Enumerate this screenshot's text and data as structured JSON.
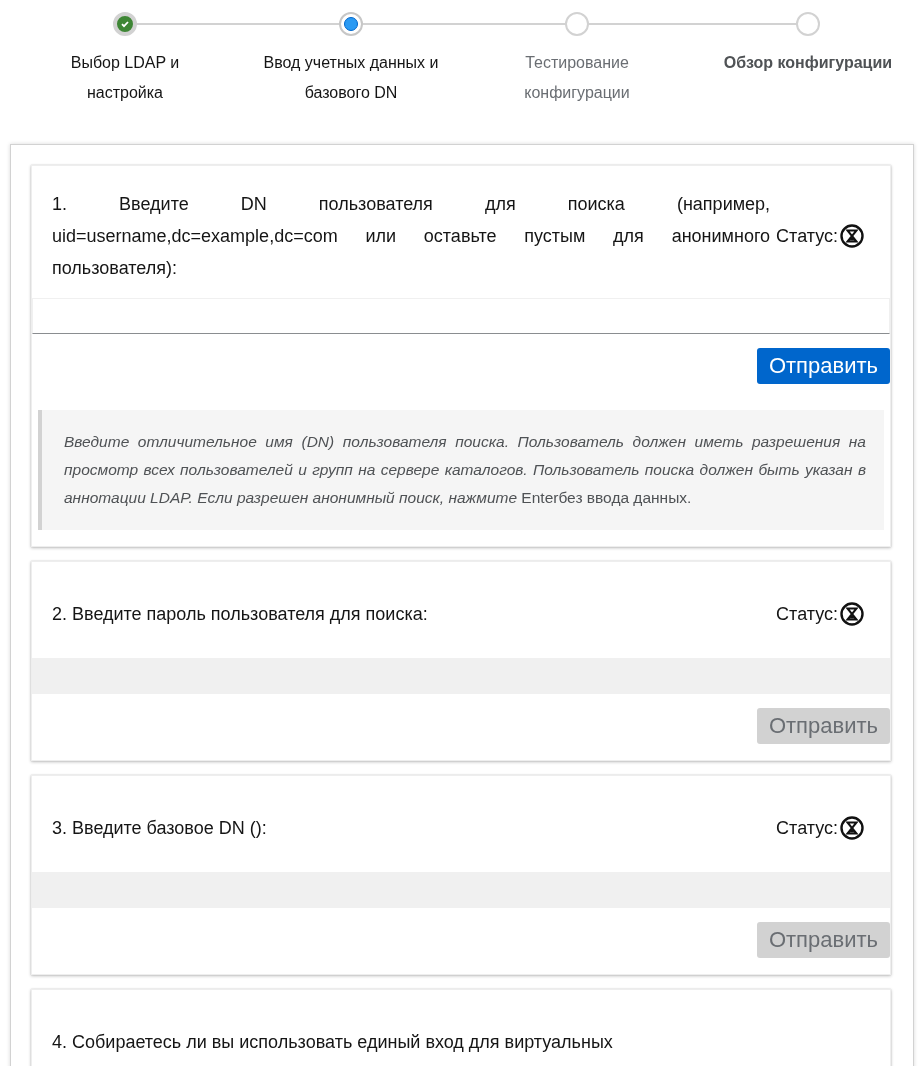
{
  "steps": [
    {
      "label": "Выбор LDAP и настройка",
      "completed": true,
      "current": false,
      "emphasized": false
    },
    {
      "label": "Ввод учетных данных и базового DN",
      "completed": false,
      "current": true,
      "emphasized": false
    },
    {
      "label": "Тестирование конфигурации",
      "completed": false,
      "current": false,
      "emphasized": false
    },
    {
      "label": "Обзор конфигурации",
      "completed": false,
      "current": false,
      "emphasized": true
    }
  ],
  "questions": [
    {
      "text": "1. Введите DN пользователя для поиска (например, uid=username,dc=example,dc=com или оставьте пустым для анонимного пользователя):",
      "status_label": "Статус:",
      "input_disabled": false,
      "submit": {
        "label": "Отправить",
        "disabled": false
      },
      "help": "*Введите отличительное имя (DN) пользователя поиска. Пользователь должен иметь разрешения на просмотр всех пользователей и групп на сервере каталогов. Пользователь поиска должен быть указан в аннотации LDAP. Если разрешен анонимный поиск, нажмите* Enterбез ввода данных."
    },
    {
      "text": "2. Введите пароль пользователя для поиска:",
      "status_label": "Статус:",
      "input_disabled": true,
      "submit": {
        "label": "Отправить",
        "disabled": true
      }
    },
    {
      "text": "3. Введите базовое DN ():",
      "status_label": "Статус:",
      "input_disabled": true,
      "submit": {
        "label": "Отправить",
        "disabled": true
      }
    },
    {
      "text": "4. Собираетесь ли вы использовать единый вход для виртуальных"
    }
  ]
}
